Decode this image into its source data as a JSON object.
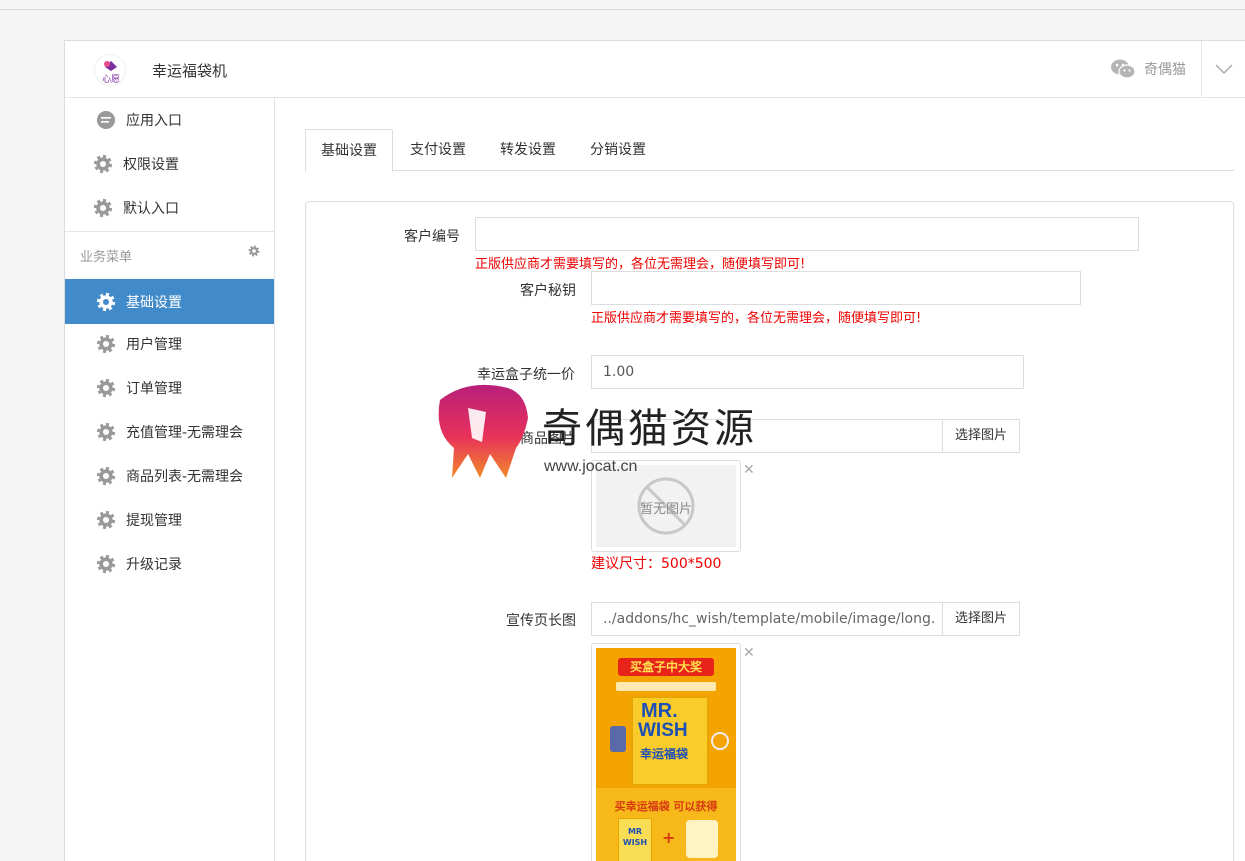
{
  "header": {
    "app_title": "幸运福袋机",
    "logo_text": "心愿",
    "username": "奇偶猫"
  },
  "sidebar": {
    "top_items": [
      {
        "label": "应用入口",
        "icon": "comment-icon"
      },
      {
        "label": "权限设置",
        "icon": "gear-icon"
      },
      {
        "label": "默认入口",
        "icon": "gear-icon"
      }
    ],
    "section_title": "业务菜单",
    "items": [
      {
        "label": "基础设置",
        "icon": "gear-icon",
        "active": true
      },
      {
        "label": "用户管理",
        "icon": "gear-icon"
      },
      {
        "label": "订单管理",
        "icon": "gear-icon"
      },
      {
        "label": "充值管理-无需理会",
        "icon": "gear-icon"
      },
      {
        "label": "商品列表-无需理会",
        "icon": "gear-icon"
      },
      {
        "label": "提现管理",
        "icon": "gear-icon"
      },
      {
        "label": "升级记录",
        "icon": "gear-icon"
      }
    ]
  },
  "tabs": [
    {
      "label": "基础设置",
      "active": true
    },
    {
      "label": "支付设置"
    },
    {
      "label": "转发设置"
    },
    {
      "label": "分销设置"
    }
  ],
  "form": {
    "customer_no": {
      "label": "客户编号",
      "value": "",
      "hint": "正版供应商才需要填写的，各位无需理会，随便填写即可!"
    },
    "customer_key": {
      "label": "客户秘钥",
      "value": "",
      "hint": "正版供应商才需要填写的，各位无需理会，随便填写即可!"
    },
    "box_price": {
      "label": "幸运盒子统一价",
      "value": "1.00"
    },
    "goods_image": {
      "label": "商品图片",
      "value": "",
      "button": "选择图片",
      "placeholder_text": "暂无图片",
      "hint": "建议尺寸：500*500"
    },
    "promo_image": {
      "label": "宣传页长图",
      "value": "../addons/hc_wish/template/mobile/image/long.",
      "button": "选择图片"
    }
  },
  "poster": {
    "banner": "买盒子中大奖",
    "brand_line1": "MR.",
    "brand_line2": "WISH",
    "brand_sub": "幸运福袋",
    "bottom_title": "买幸运福袋 可以获得",
    "mini_brand": "MR WISH",
    "plus": "+"
  },
  "watermark": {
    "text": "奇偶猫资源",
    "url": "www.jocat.cn"
  },
  "colors": {
    "accent": "#428bca",
    "hint": "#e00000",
    "poster_yellow": "#f7b81a"
  }
}
